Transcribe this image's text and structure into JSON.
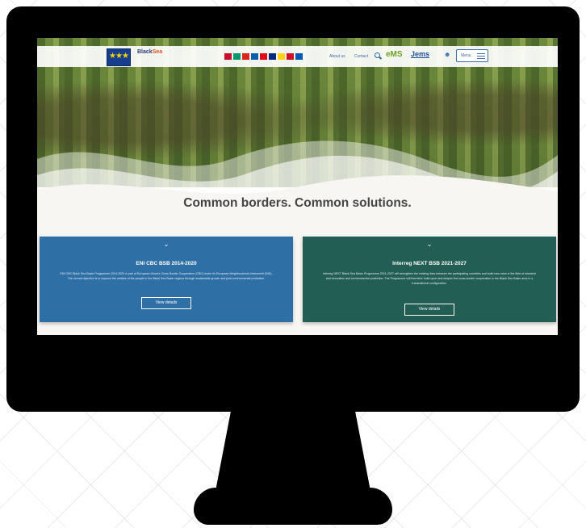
{
  "topbar": {
    "eu_mark": "★★★",
    "logo_text": "Black",
    "logo_text_accent": "Sea",
    "nav": [
      "About us",
      "Contact"
    ],
    "ems_label": "eMS",
    "jems_label": "Jems",
    "menu_label": "Menu"
  },
  "flags": [
    "#c8102e",
    "#00966e",
    "#da291c",
    "#0d5eaf",
    "#e30a17",
    "#002b7f",
    "#fcd116",
    "#ce1126",
    "#0057b7"
  ],
  "headline": "Common borders. Common solutions.",
  "cards": [
    {
      "title": "ENI CBC BSB 2014-2020",
      "text": "ENI CBC Black Sea Basin Programme 2014-2020 is part of European Union's Cross Border Cooperation (CBC) under its European Neighbourhood Instrument (ENI). The overall objective is to improve the welfare of the people in the Black Sea Basin regions through sustainable growth and joint environmental protection.",
      "button": "View details",
      "color": "#2e6fa5"
    },
    {
      "title": "Interreg NEXT BSB 2021-2027",
      "text": "Interreg NEXT Black Sea Basin Programme 2021-2027 will strengthen the existing links between the participating countries and build new ones in the field of research and innovation and environmental protection. The Programme will therefore build upon and deepen the cross-border cooperation in the Black Sea Basin area in a transnational configuration.",
      "button": "View details",
      "color": "#235e54"
    }
  ]
}
